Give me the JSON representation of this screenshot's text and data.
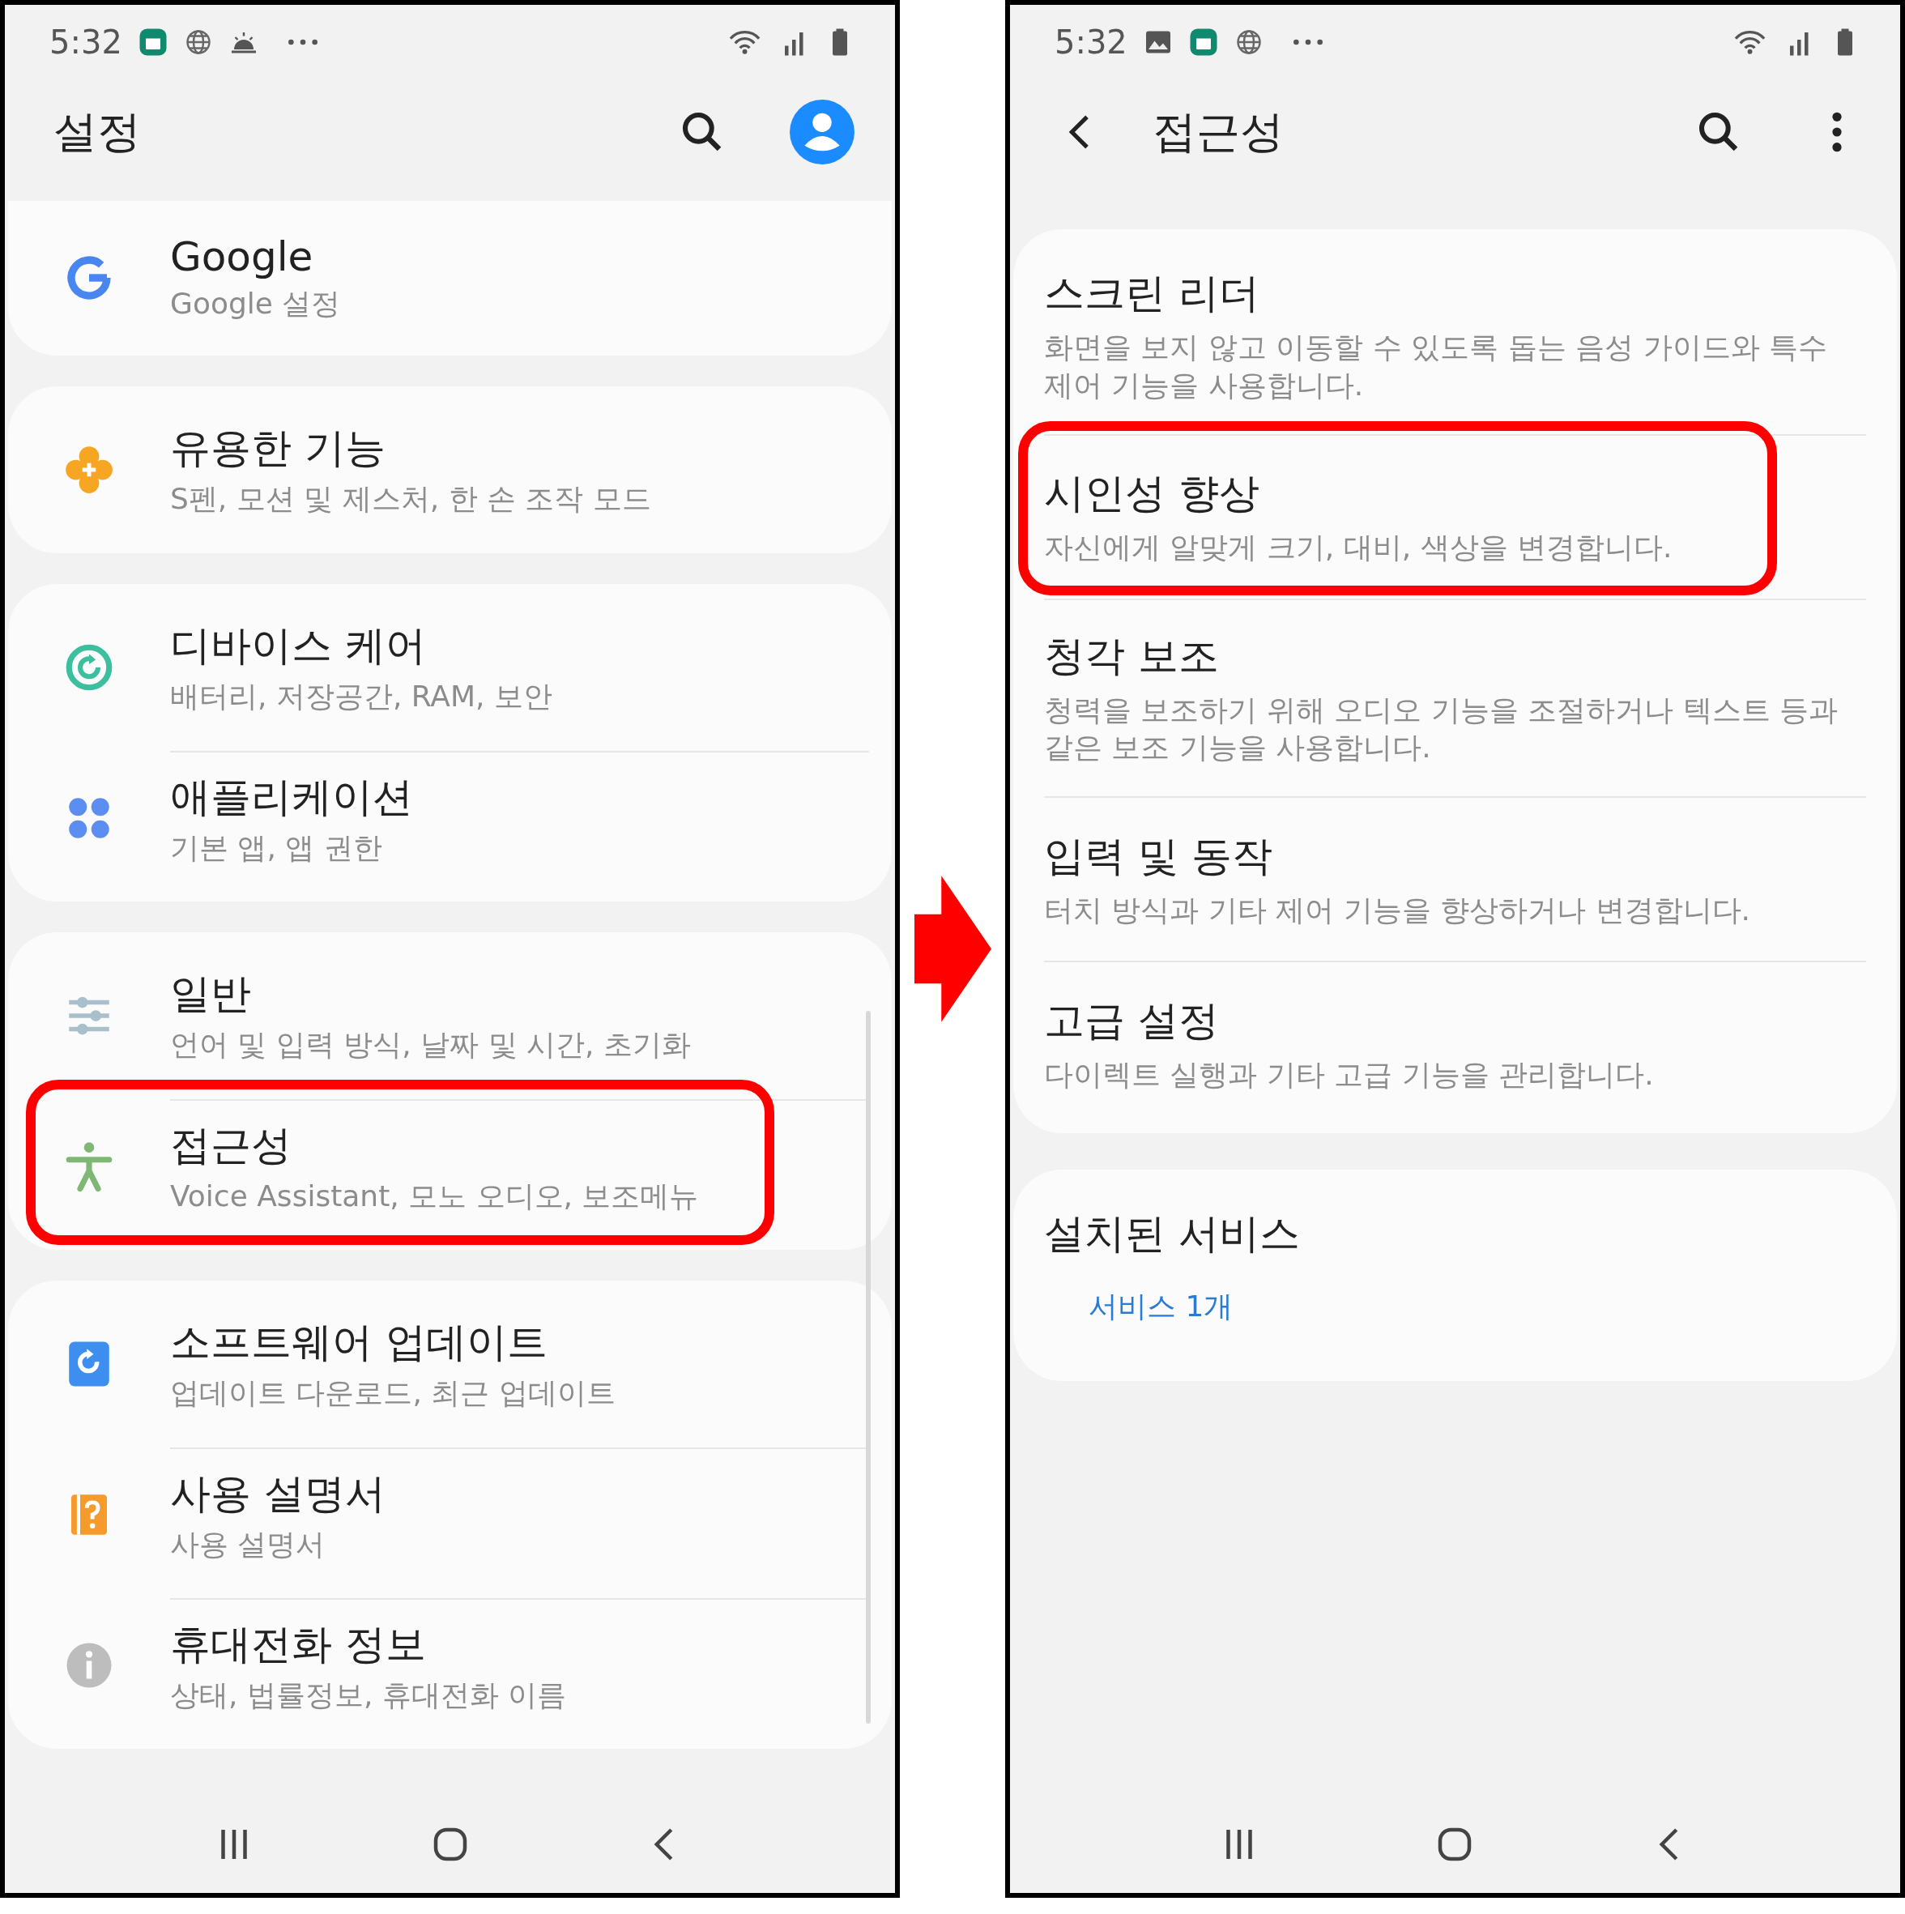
{
  "screens": [
    {
      "status_bar": {
        "time": "5:32"
      },
      "header": {
        "kind": "root",
        "title": "설정"
      },
      "groups": [
        {
          "items": [
            {
              "title": "Google",
              "subtitle": "Google 설정",
              "highlighted": false
            }
          ]
        },
        {
          "items": [
            {
              "title": "유용한 기능",
              "subtitle": "S펜, 모션 및 제스처, 한 손 조작 모드",
              "highlighted": false
            }
          ]
        },
        {
          "items": [
            {
              "title": "디바이스 케어",
              "subtitle": "배터리, 저장공간, RAM, 보안",
              "highlighted": false
            },
            {
              "title": "애플리케이션",
              "subtitle": "기본 앱, 앱 권한",
              "highlighted": false
            }
          ]
        },
        {
          "items": [
            {
              "title": "일반",
              "subtitle": "언어 및 입력 방식, 날짜 및 시간, 초기화",
              "highlighted": false
            },
            {
              "title": "접근성",
              "subtitle": "Voice Assistant, 모노 오디오, 보조메뉴",
              "highlighted": true
            }
          ]
        },
        {
          "items": [
            {
              "title": "소프트웨어 업데이트",
              "subtitle": "업데이트 다운로드, 최근 업데이트",
              "highlighted": false
            },
            {
              "title": "사용 설명서",
              "subtitle": "사용 설명서",
              "highlighted": false
            },
            {
              "title": "휴대전화 정보",
              "subtitle": "상태, 법률정보, 휴대전화 이름",
              "highlighted": false
            }
          ]
        }
      ]
    },
    {
      "status_bar": {
        "time": "5:32"
      },
      "header": {
        "kind": "sub",
        "title": "접근성"
      },
      "groups": [
        {
          "items": [
            {
              "title": "스크린 리더",
              "subtitle": "화면을 보지 않고 이동할 수 있도록 돕는 음성 가이드와 특수 제어 기능을 사용합니다.",
              "highlighted": false
            },
            {
              "title": "시인성 향상",
              "subtitle": "자신에게 알맞게 크기, 대비, 색상을 변경합니다.",
              "highlighted": true
            },
            {
              "title": "청각 보조",
              "subtitle": "청력을 보조하기 위해 오디오 기능을 조절하거나 텍스트 등과 같은 보조 기능을 사용합니다.",
              "highlighted": false
            },
            {
              "title": "입력 및 동작",
              "subtitle": "터치 방식과 기타 제어 기능을 향상하거나 변경합니다.",
              "highlighted": false
            },
            {
              "title": "고급 설정",
              "subtitle": "다이렉트 실행과 기타 고급 기능을 관리합니다.",
              "highlighted": false
            }
          ]
        },
        {
          "items": [
            {
              "title": "설치된 서비스",
              "subtitle": "서비스 1개",
              "highlighted": false,
              "kind": "status"
            }
          ]
        }
      ]
    }
  ]
}
